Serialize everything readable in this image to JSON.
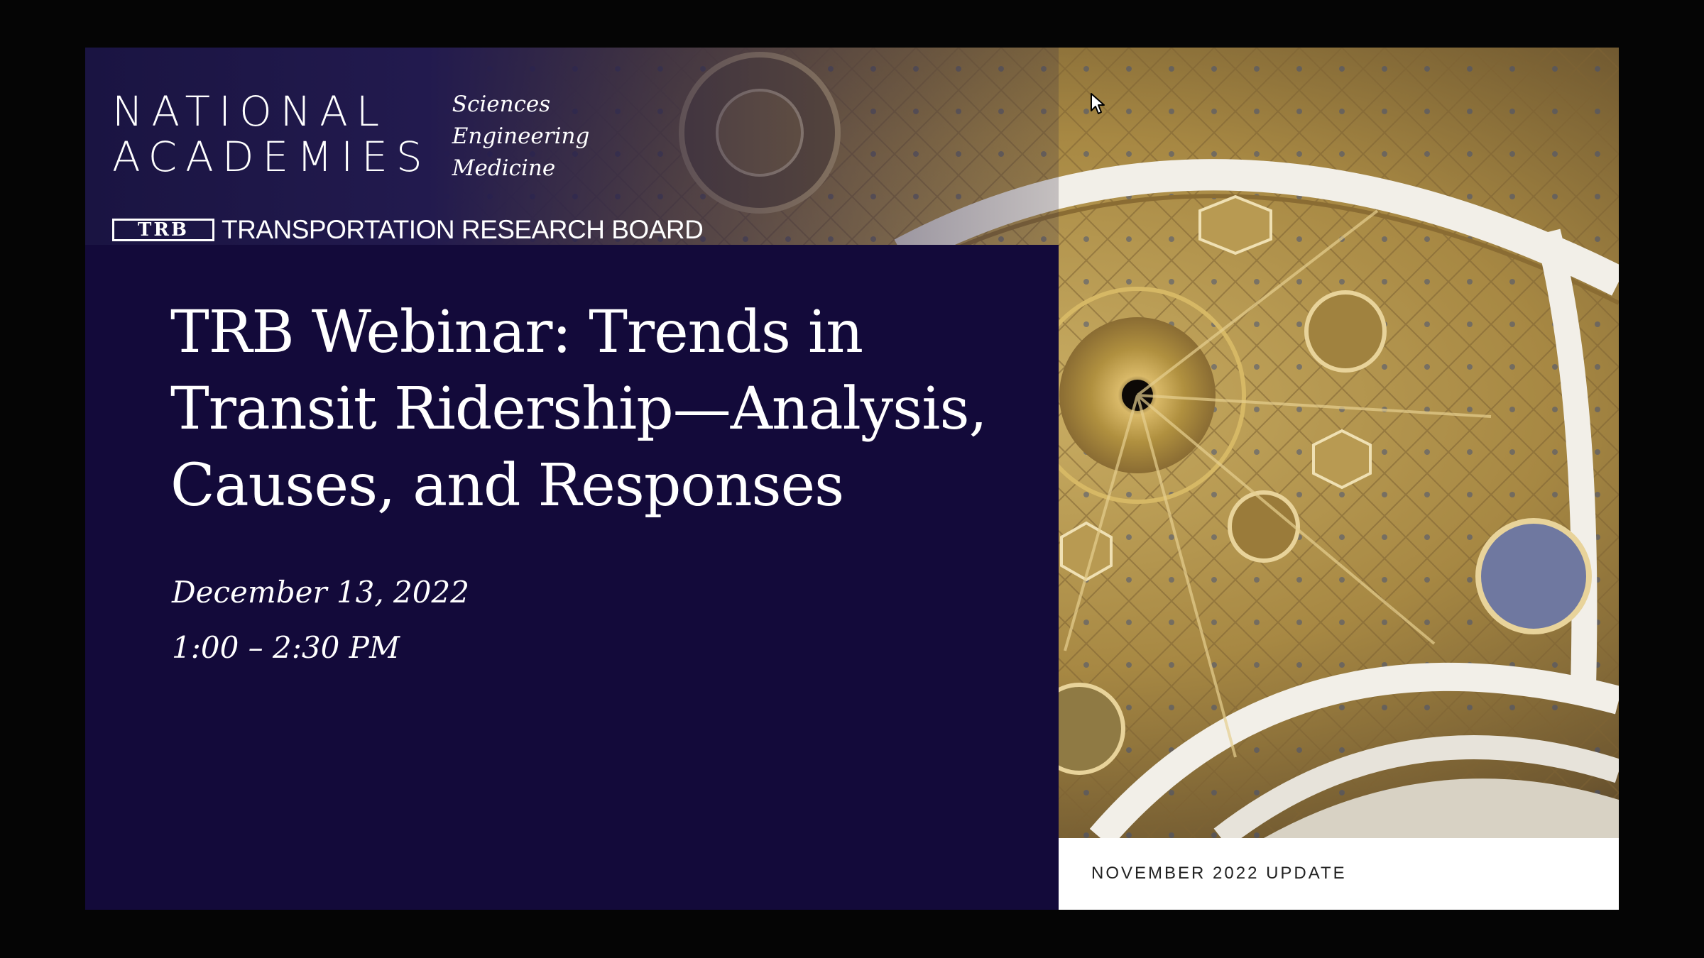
{
  "logo": {
    "wordmark_line1": "NATIONAL",
    "wordmark_line2": "ACADEMIES",
    "divisions": [
      "Sciences",
      "Engineering",
      "Medicine"
    ]
  },
  "trb": {
    "abbrev": "TRB",
    "name": "TRANSPORTATION RESEARCH BOARD"
  },
  "slide": {
    "title": "TRB Webinar: Trends in Transit Ridership—Analysis, Causes, and Responses",
    "date": "December 13, 2022",
    "time": "1:00 – 2:30 PM",
    "footer": "NOVEMBER 2022 UPDATE"
  },
  "colors": {
    "panel": "#130a3a",
    "gold": "#b89a52",
    "arch_white": "#f2efe8"
  },
  "icons": {
    "cursor": "mouse-pointer-icon"
  }
}
